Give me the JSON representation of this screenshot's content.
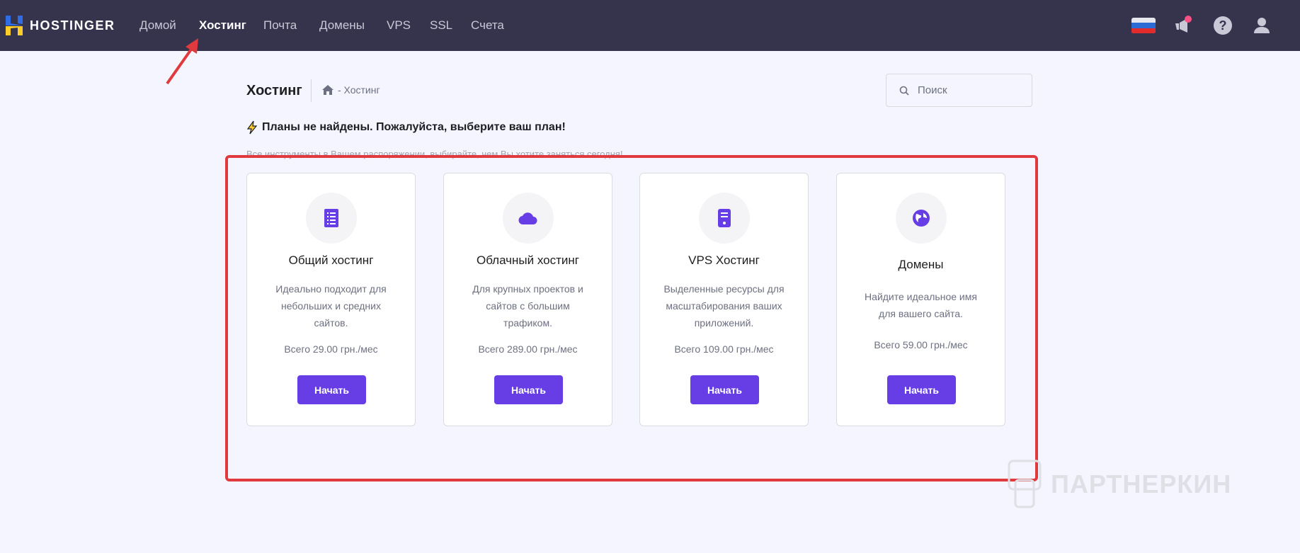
{
  "nav": {
    "brand": "HOSTINGER",
    "items": [
      {
        "label": "Домой"
      },
      {
        "label": "Хостинг",
        "active": true
      },
      {
        "label": "Почта"
      },
      {
        "label": "Домены"
      },
      {
        "label": "VPS"
      },
      {
        "label": "SSL"
      },
      {
        "label": "Счета"
      }
    ]
  },
  "header": {
    "title": "Хостинг",
    "breadcrumb": "- Хостинг",
    "search_placeholder": "Поиск"
  },
  "alert": "Планы не найдены. Пожалуйста, выберите ваш план!",
  "subtitle": "Все инструменты в Вашем распоряжении, выбирайте, чем Вы хотите заняться сегодня!",
  "cards": [
    {
      "title": "Общий хостинг",
      "desc": "Идеально подходит для небольших и средних сайтов.",
      "price": "Всего 29.00 грн./мес",
      "button": "Начать",
      "icon": "list-icon"
    },
    {
      "title": "Облачный хостинг",
      "desc": "Для крупных проектов и сайтов с большим трафиком.",
      "price": "Всего 289.00 грн./мес",
      "button": "Начать",
      "icon": "cloud-icon"
    },
    {
      "title": "VPS Хостинг",
      "desc": "Выделенные ресурсы для масштабирования ваших приложений.",
      "price": "Всего 109.00 грн./мес",
      "button": "Начать",
      "icon": "server-icon"
    },
    {
      "title": "Домены",
      "desc": "Найдите идеальное имя для вашего сайта.",
      "price": "Всего 59.00 грн./мес",
      "button": "Начать",
      "icon": "globe-icon"
    }
  ],
  "watermark": "ПАРТНЕРКИН",
  "colors": {
    "nav": "#36344d",
    "accent": "#673de6",
    "annotation": "#e0393e"
  }
}
